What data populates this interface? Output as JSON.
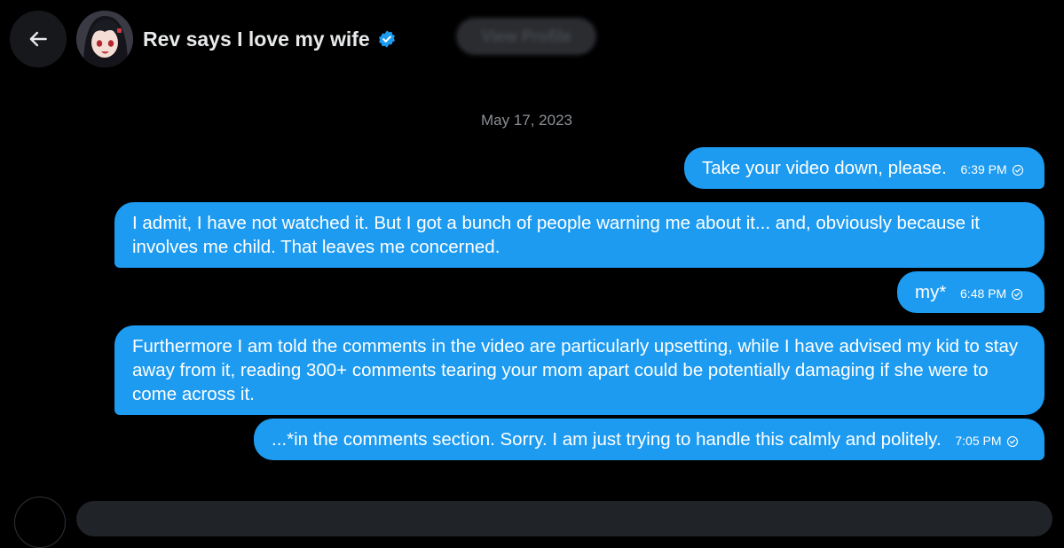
{
  "header": {
    "name": "Rev says I love my wife",
    "verified": true,
    "view_profile_label": "View Profile"
  },
  "conversation": {
    "date": "May 17, 2023",
    "messages": [
      {
        "side": "right",
        "text": "Take your video down, please.",
        "time": "6:39 PM"
      },
      {
        "side": "left",
        "text": "I admit, I have not watched it.  But I got a bunch of people warning me about it... and, obviously because it involves me child. That leaves me concerned."
      },
      {
        "side": "right",
        "text": "my*",
        "time": "6:48 PM"
      },
      {
        "side": "left",
        "text": "Furthermore I am told the comments in the video are particularly upsetting, while I have advised my kid to stay away from it, reading 300+ comments tearing your mom apart could be potentially damaging if she were to come across it."
      },
      {
        "side": "right",
        "text": "...*in the comments section. Sorry. I am just trying to handle this calmly and politely.",
        "time": "7:05 PM"
      }
    ]
  },
  "colors": {
    "background": "#000000",
    "bubble": "#1d9bf0",
    "text": "#e7e9ea",
    "muted": "#8b8f94"
  },
  "icons": {
    "back": "arrow-left-icon",
    "verified": "verified-badge-icon",
    "sent": "check-circle-icon"
  }
}
